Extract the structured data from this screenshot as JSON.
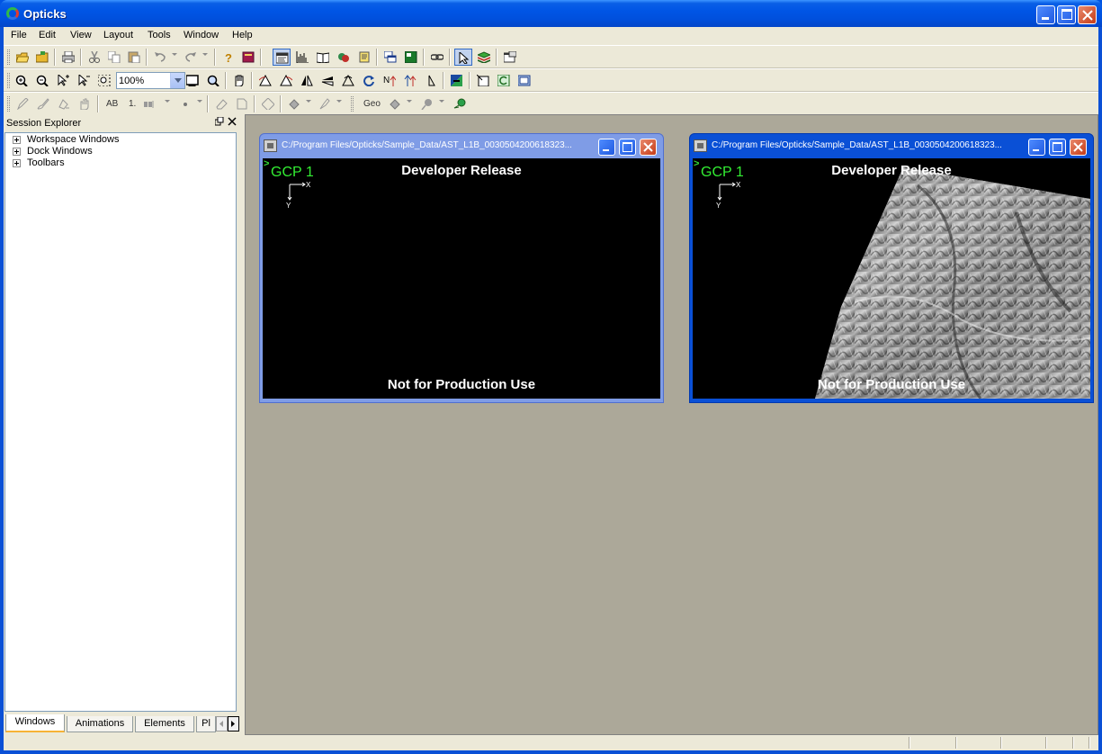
{
  "app": {
    "title": "Opticks"
  },
  "menu": [
    "File",
    "Edit",
    "View",
    "Layout",
    "Tools",
    "Window",
    "Help"
  ],
  "toolbar": {
    "zoom_value": "100%",
    "geo_label": "Geo",
    "ab_label": "AB",
    "one_label": "1."
  },
  "explorer": {
    "title": "Session Explorer",
    "tree": [
      "Workspace Windows",
      "Dock Windows",
      "Toolbars"
    ],
    "tabs": [
      "Windows",
      "Animations",
      "Elements",
      "Pl"
    ]
  },
  "children": [
    {
      "caption": "C:/Program Files/Opticks/Sample_Data/AST_L1B_0030504200618323...",
      "gcp": "GCP 1",
      "axis_x": "X",
      "axis_y": "Y",
      "top_text": "Developer Release",
      "bottom_text": "Not for Production Use"
    },
    {
      "caption": "C:/Program Files/Opticks/Sample_Data/AST_L1B_0030504200618323...",
      "gcp": "GCP 1",
      "axis_x": "X",
      "axis_y": "Y",
      "top_text": "Developer Release",
      "bottom_text": "Not for Production Use"
    }
  ],
  "colors": {
    "title_blue": "#0054e3",
    "workspace_bg": "#aca899",
    "gcp_green": "#33ee33"
  }
}
